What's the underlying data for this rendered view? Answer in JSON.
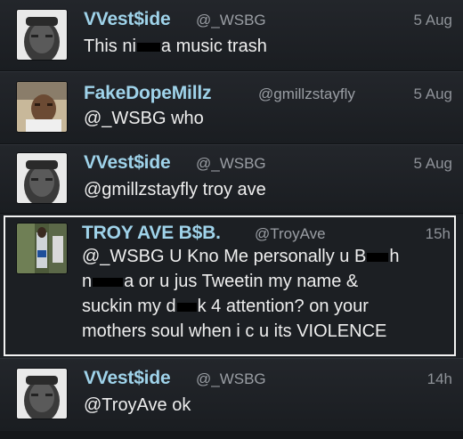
{
  "tweets": [
    {
      "name": "VVest$ide",
      "handle": "@_WSBG",
      "time": "5 Aug",
      "text_parts": [
        "This ni",
        "a music trash"
      ]
    },
    {
      "name": "FakeDopeMillz",
      "handle": "@gmillzstayfly",
      "time": "5 Aug",
      "text": "@_WSBG who"
    },
    {
      "name": "VVest$ide",
      "handle": "@_WSBG",
      "time": "5 Aug",
      "text": "@gmillzstayfly troy ave"
    },
    {
      "name": "TROY AVE B$B.",
      "handle": "@TroyAve",
      "time": "15h",
      "lines": [
        [
          "@_WSBG U Kno Me personally u B",
          "h"
        ],
        [
          "n",
          "a or u jus Tweetin my name &"
        ],
        [
          "suckin my d",
          "k 4 attention? on your"
        ],
        [
          "mothers soul when i c u its VIOLENCE"
        ]
      ]
    },
    {
      "name": "VVest$ide",
      "handle": "@_WSBG",
      "time": "14h",
      "text": "@TroyAve ok"
    }
  ],
  "colors": {
    "name": "#9fd3ea",
    "handle": "#9a9ea4",
    "text": "#eeeeee",
    "background": "#1d2024",
    "highlight_border": "#f2f2f2"
  }
}
